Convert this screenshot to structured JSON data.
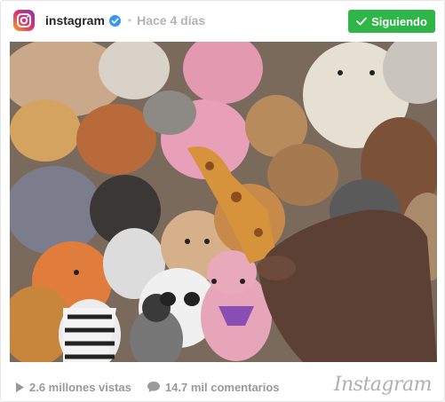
{
  "header": {
    "username": "instagram",
    "separator": "•",
    "timestamp": "Hace 4 días",
    "follow_label": "Siguiendo",
    "logo_icon": "instagram-logo-icon",
    "verified_icon": "verified-badge-icon"
  },
  "media": {
    "description_icon": "video-thumbnail"
  },
  "footer": {
    "views": "2.6 millones vistas",
    "comments": "14.7 mil comentarios",
    "brand": "Instagram"
  },
  "colors": {
    "follow_button": "#2fb548",
    "verified": "#3897f0",
    "muted_text": "#999999"
  }
}
